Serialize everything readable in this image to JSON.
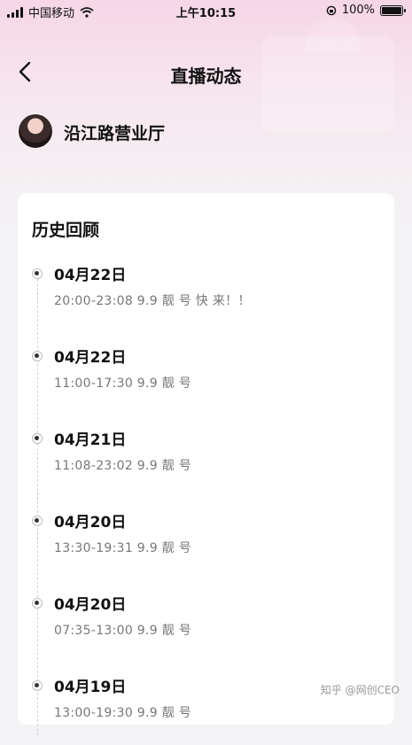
{
  "status_bar": {
    "carrier": "中国移动",
    "time": "上午10:15",
    "battery": "100%"
  },
  "nav": {
    "title": "直播动态"
  },
  "profile": {
    "name": "沿江路营业厅"
  },
  "history": {
    "title": "历史回顾",
    "items": [
      {
        "date": "04月22日",
        "desc": "20:00-23:08 9.9 靓 号 快 来！！"
      },
      {
        "date": "04月22日",
        "desc": "11:00-17:30 9.9 靓 号"
      },
      {
        "date": "04月21日",
        "desc": "11:08-23:02 9.9 靓 号"
      },
      {
        "date": "04月20日",
        "desc": "13:30-19:31 9.9 靓 号"
      },
      {
        "date": "04月20日",
        "desc": "07:35-13:00 9.9 靓 号"
      },
      {
        "date": "04月19日",
        "desc": "13:00-19:30 9.9 靓 号"
      }
    ]
  },
  "watermark": "知乎 @网创CEO"
}
